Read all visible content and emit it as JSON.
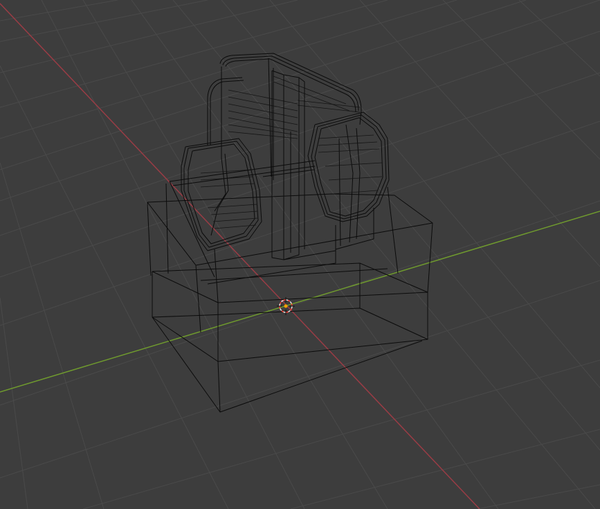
{
  "viewport": {
    "background_color": "#3d3d3d",
    "grid_color": "#4a4a4a",
    "x_axis_color": "#9a3c45",
    "y_axis_color": "#6f9a2e",
    "wireframe_color": "#0b0b0b",
    "origin_marker_colors": [
      "#e8e8e8",
      "#ff3b2f",
      "#f2a100"
    ]
  },
  "icons": {
    "origin": "3d-cursor-icon"
  }
}
